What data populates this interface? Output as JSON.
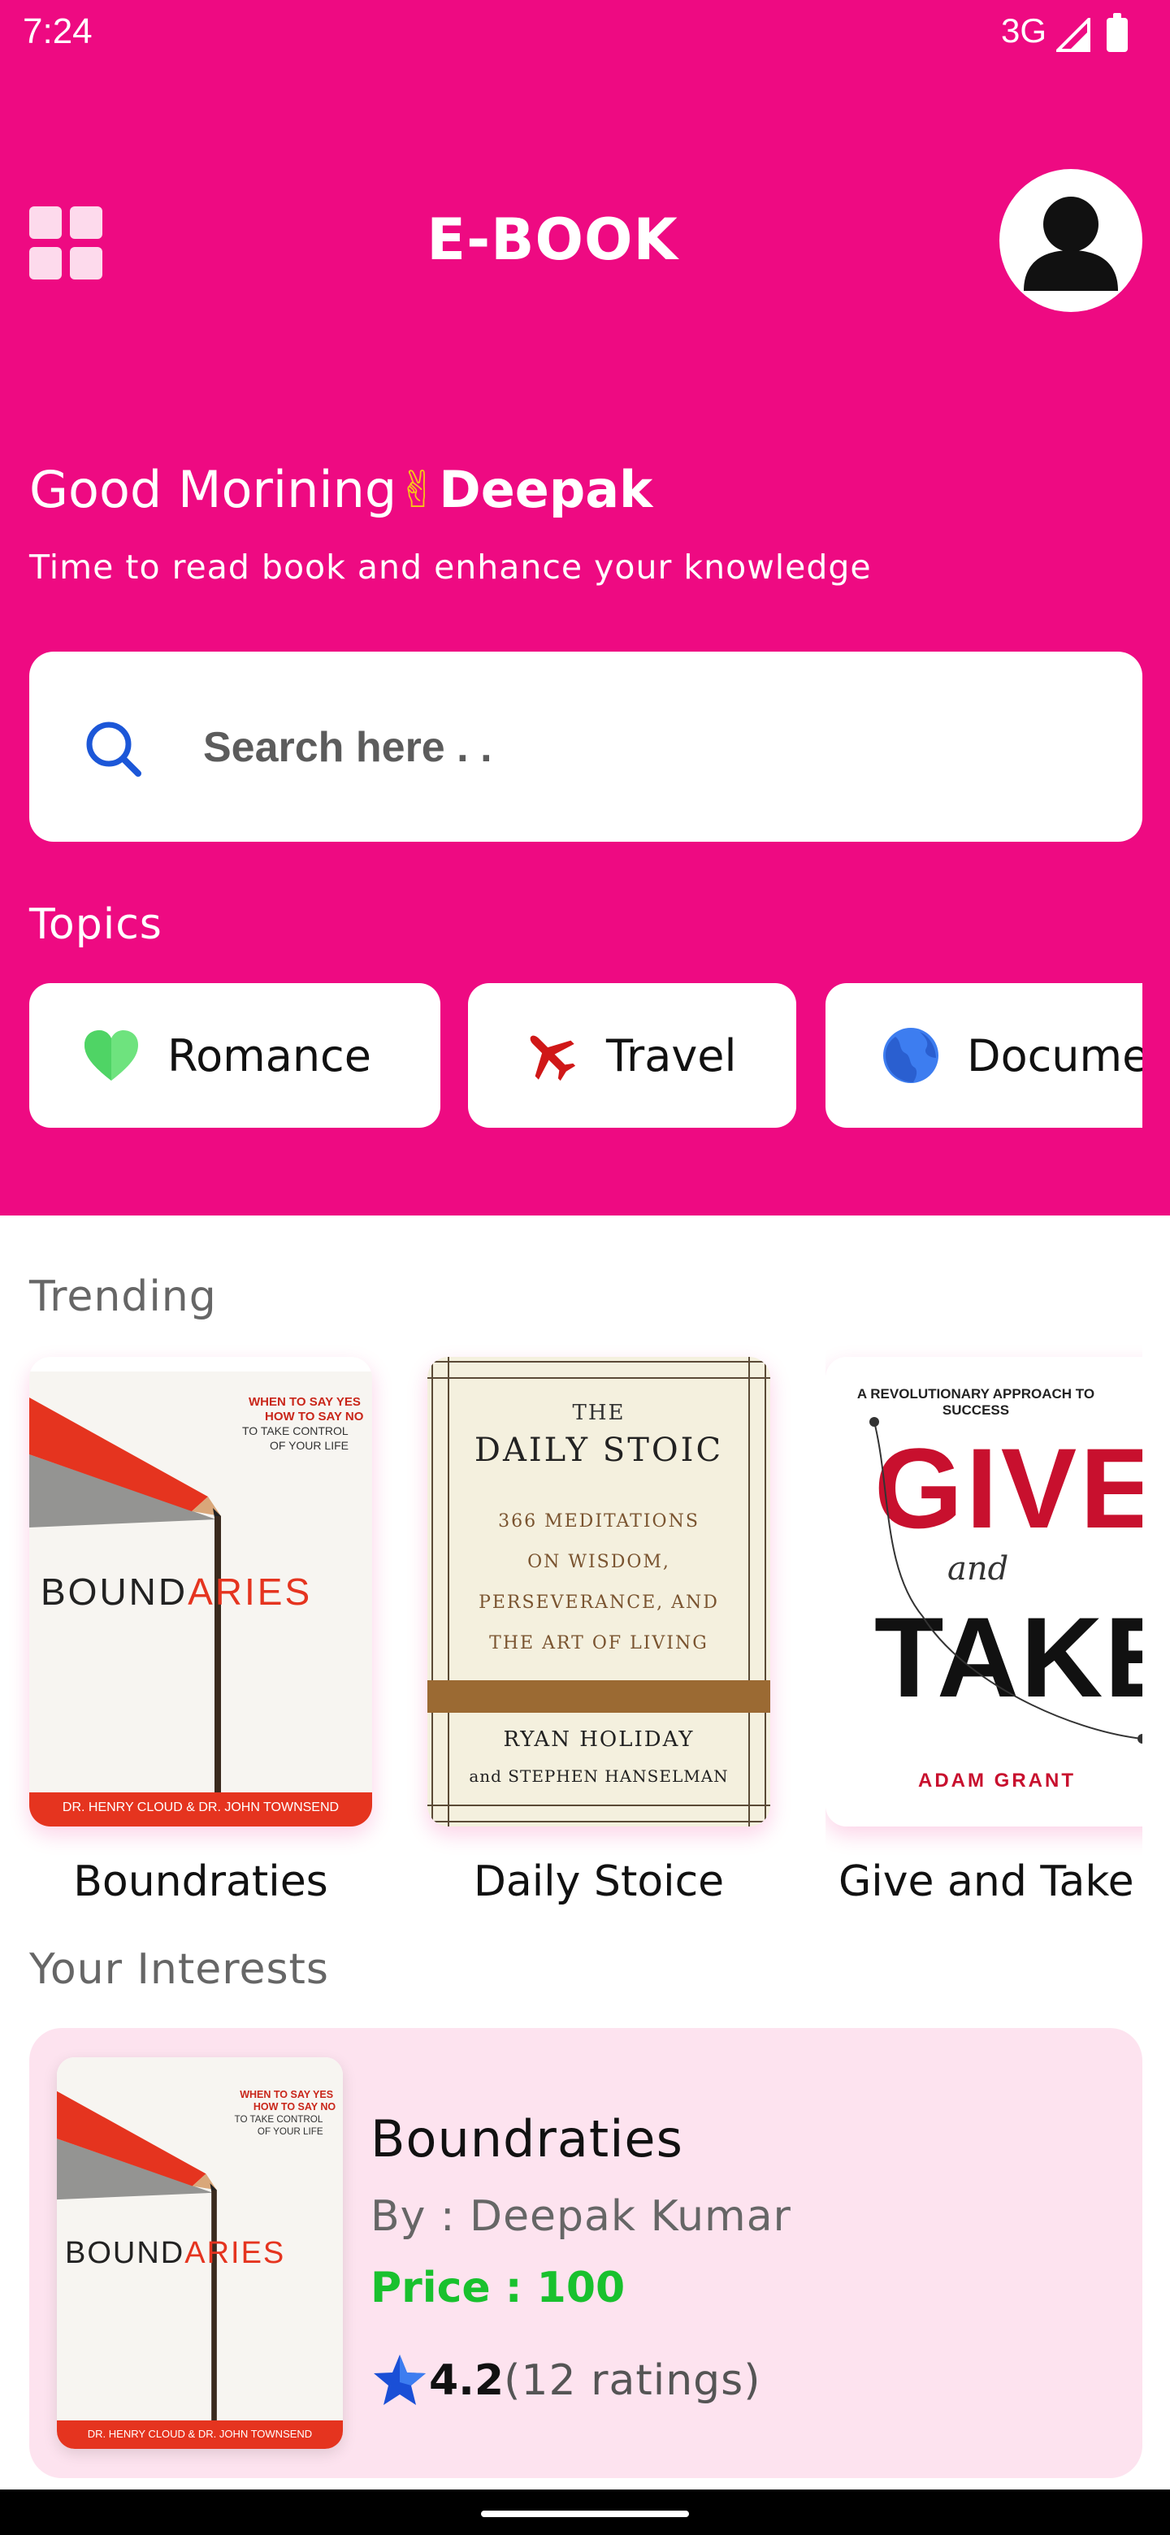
{
  "status_bar": {
    "time": "7:24",
    "network": "3G"
  },
  "header": {
    "title": "E-BOOK"
  },
  "greeting": {
    "prefix": "Good Morining",
    "emoji": "✌",
    "name": "Deepak",
    "subtitle": "Time to read book and enhance your knowledge"
  },
  "search": {
    "placeholder": "Search here . ."
  },
  "topics": {
    "label": "Topics",
    "items": [
      {
        "label": "Romance",
        "icon": "heart-icon",
        "color": "#6ee37e"
      },
      {
        "label": "Travel",
        "icon": "airplane-icon",
        "color": "#d01818"
      },
      {
        "label": "Docume",
        "icon": "globe-icon",
        "color": "#3d7df0"
      }
    ]
  },
  "trending": {
    "label": "Trending",
    "books": [
      {
        "title": "Boundraties",
        "cover_word_a": "BOUND",
        "cover_word_b": "ARIES",
        "cover_authors": "DR. HENRY CLOUD & DR. JOHN TOWNSEND"
      },
      {
        "title": "Daily Stoice",
        "cover_head": "THE",
        "cover_main": "DAILY STOIC",
        "cover_lines": [
          "366 MEDITATIONS",
          "ON WISDOM,",
          "PERSEVERANCE, AND",
          "THE ART OF LIVING"
        ],
        "cover_author_1": "RYAN HOLIDAY",
        "cover_author_2": "and STEPHEN HANSELMAN"
      },
      {
        "title": "Give and Take",
        "cover_tag": "A REVOLUTIONARY APPROACH TO SUCCESS",
        "cover_word_1": "GIVE",
        "cover_word_mid": "and",
        "cover_word_2": "TAKE",
        "cover_author": "ADAM GRANT"
      }
    ]
  },
  "interests": {
    "label": "Your Interests",
    "book": {
      "title": "Boundraties",
      "author": "By : Deepak Kumar",
      "price": "Price : 100",
      "rating": "4.2",
      "ratings_count": "(12 ratings)"
    }
  },
  "colors": {
    "brand": "#ee0a82",
    "card_tint": "#fde3ef",
    "price": "#19c12e",
    "star": "#1a4fd6"
  }
}
